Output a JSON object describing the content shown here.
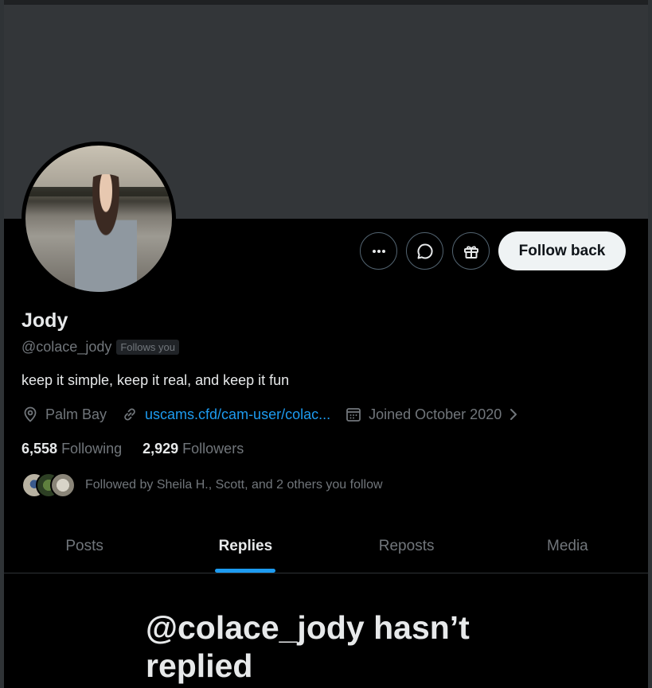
{
  "profile": {
    "name": "Jody",
    "handle": "@colace_jody",
    "follows_you_badge": "Follows you",
    "bio": "keep it simple, keep it real, and keep it fun",
    "location": "Palm Bay",
    "website": "uscams.cfd/cam-user/colac...",
    "joined": "Joined October 2020"
  },
  "actions": {
    "more_icon": "more-icon",
    "message_icon": "message-icon",
    "gift_icon": "gift-icon",
    "follow_back_label": "Follow back"
  },
  "stats": {
    "following_count": "6,558",
    "following_label": "Following",
    "followers_count": "2,929",
    "followers_label": "Followers"
  },
  "followed_by": "Followed by Sheila H., Scott, and 2 others you follow",
  "tabs": [
    {
      "label": "Posts",
      "active": false
    },
    {
      "label": "Replies",
      "active": true
    },
    {
      "label": "Reposts",
      "active": false
    },
    {
      "label": "Media",
      "active": false
    }
  ],
  "empty_state": {
    "title": "@colace_jody hasn’t replied"
  },
  "colors": {
    "accent": "#1d9bf0",
    "banner": "#333639",
    "background": "#000000"
  }
}
